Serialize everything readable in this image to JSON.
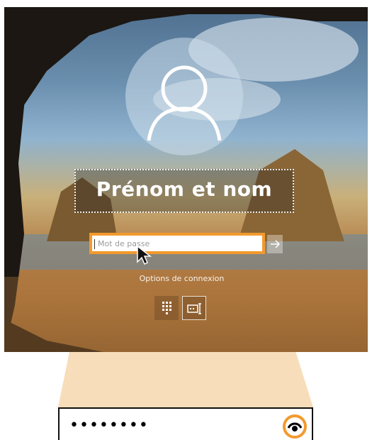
{
  "lockscreen": {
    "user_name": "Prénom et nom",
    "password_placeholder": "Mot de passe",
    "signin_options_label": "Options de connexion",
    "signin_options": [
      {
        "icon": "pin-keypad-icon"
      },
      {
        "icon": "password-key-icon"
      }
    ],
    "submit_icon": "arrow-right-icon"
  },
  "zoom_callout": {
    "masked_password": "••••••••",
    "reveal_icon": "eye-reveal-icon"
  },
  "colors": {
    "highlight": "#f29a2e",
    "callout_fill": "#f6d7ad"
  }
}
